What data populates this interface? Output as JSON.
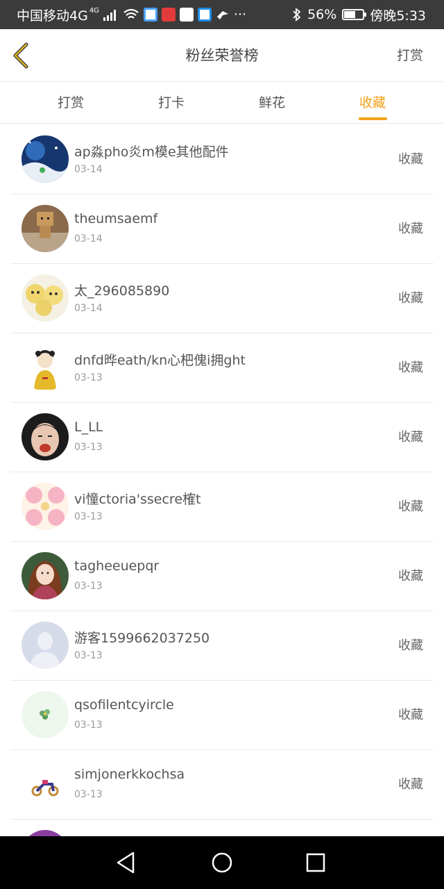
{
  "status_bar": {
    "carrier": "中国移动4G",
    "network_sup": "4G",
    "battery_text": "56%",
    "battery_level": 0.56,
    "time": "傍晚5:33",
    "more": "···"
  },
  "header": {
    "title": "粉丝荣誉榜",
    "action": "打赏"
  },
  "tabs": [
    {
      "label": "打赏"
    },
    {
      "label": "打卡"
    },
    {
      "label": "鲜花"
    },
    {
      "label": "收藏"
    }
  ],
  "active_tab": "收藏",
  "list": [
    {
      "name": "ap淼pho炎m模e其他配件",
      "date": "03-14",
      "kind": "收藏",
      "avatar": "starry-night"
    },
    {
      "name": "theumsaemf",
      "date": "03-14",
      "kind": "收藏",
      "avatar": "cardboard-robot"
    },
    {
      "name": "太_296085890",
      "date": "03-14",
      "kind": "收藏",
      "avatar": "yellow-bears"
    },
    {
      "name": "dnfd晔eath/kn心杷傀i拥ght",
      "date": "03-13",
      "kind": "收藏",
      "avatar": "cartoon-girl-yellow-shirt"
    },
    {
      "name": "L_LL",
      "date": "03-13",
      "kind": "收藏",
      "avatar": "boy-tongue-out"
    },
    {
      "name": "vi憧ctoria'ssecre榷t",
      "date": "03-13",
      "kind": "收藏",
      "avatar": "pink-flowers"
    },
    {
      "name": "tagheeuepqr",
      "date": "03-13",
      "kind": "收藏",
      "avatar": "anime-girl"
    },
    {
      "name": "游客1599662037250",
      "date": "03-13",
      "kind": "收藏",
      "avatar": "default-user"
    },
    {
      "name": "qsofilentcyircle",
      "date": "03-13",
      "kind": "收藏",
      "avatar": "small-flower"
    },
    {
      "name": "simjonerkkochsa",
      "date": "03-13",
      "kind": "收藏",
      "avatar": "motorbike"
    }
  ],
  "colors": {
    "accent": "#f2a21a",
    "status_bar": "#3b3b3b",
    "nav_bar": "#000000"
  }
}
